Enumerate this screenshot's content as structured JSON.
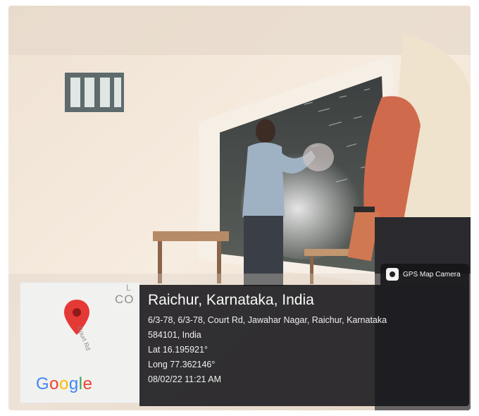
{
  "overlay": {
    "badge_label": "GPS Map Camera",
    "city_line": "Raichur, Karnataka, India",
    "address_line_1": "6/3-78, 6/3-78, Court Rd, Jawahar Nagar, Raichur, Karnataka",
    "address_line_2": "584101, India",
    "latitude": "Lat 16.195921°",
    "longitude": "Long 77.362146°",
    "timestamp": "08/02/22 11:21 AM"
  },
  "map": {
    "brand": "Google",
    "street_label": "Court Rd",
    "partial_text_top": "L",
    "partial_text_mid": "CO"
  },
  "colors": {
    "pin": "#e53935",
    "overlay_bg": "#121216"
  }
}
